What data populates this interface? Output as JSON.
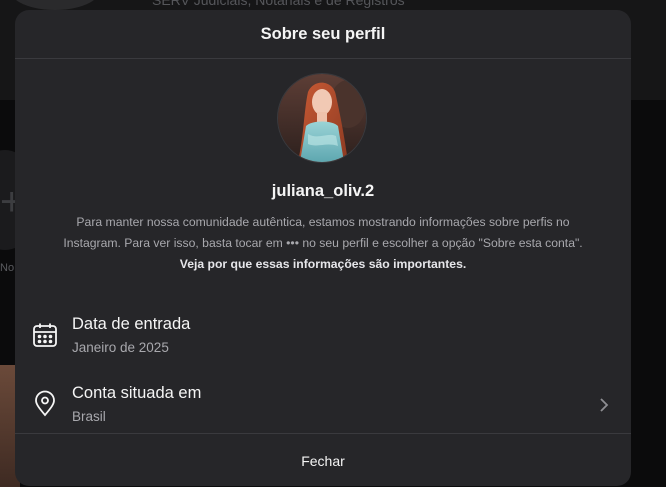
{
  "background": {
    "header_text": "SERV Judiciais, Notariais e de Registros",
    "side_label": "No"
  },
  "modal": {
    "title": "Sobre seu perfil",
    "username": "juliana_oliv.2",
    "description_text": "Para manter nossa comunidade autêntica, estamos mostrando informações sobre perfis no Instagram. Para ver isso, basta tocar em ••• no seu perfil e escolher a opção \"Sobre esta conta\". ",
    "description_link": "Veja por que essas informações são importantes.",
    "rows": [
      {
        "title": "Data de entrada",
        "value": "Janeiro de 2025",
        "icon": "calendar-icon"
      },
      {
        "title": "Conta situada em",
        "value": "Brasil",
        "icon": "location-pin-icon"
      }
    ],
    "close_label": "Fechar"
  },
  "colors": {
    "modal_bg": "#262629",
    "divider": "#3a3a3e",
    "text_primary": "#f5f5f5",
    "text_secondary": "#a8a8ad"
  }
}
